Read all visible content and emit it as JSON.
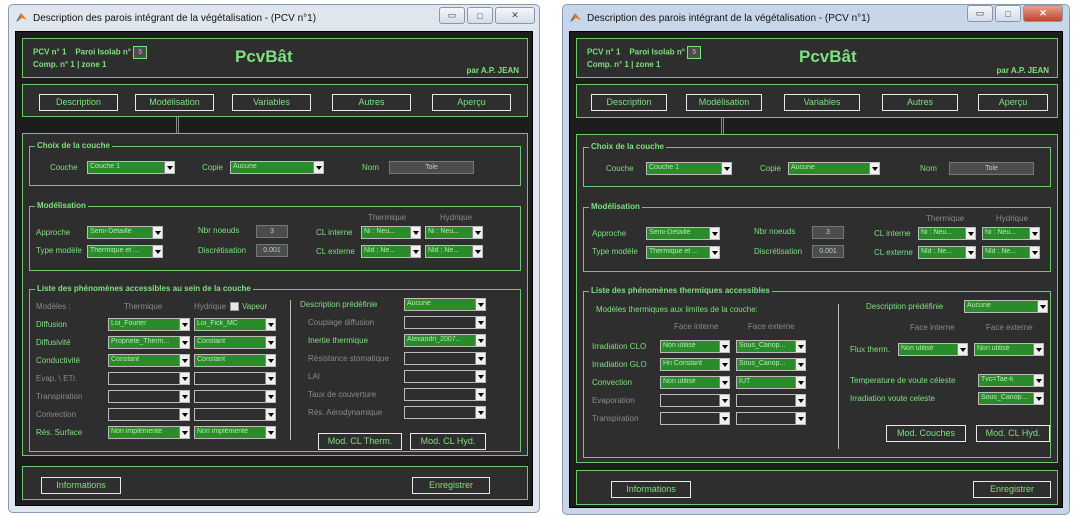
{
  "common": {
    "app_title": "PcvBât",
    "author": "par A.P. JEAN",
    "pcv_label": "PCV n° 1",
    "paroi_label": "Paroi Isolab n°",
    "paroi_value": "5",
    "comp_label": "Comp. n° 1 | zone 1",
    "tabs": [
      "Description",
      "Modélisation",
      "Variables",
      "Autres",
      "Aperçu"
    ],
    "informations_button": "Informations",
    "enregistrer_button": "Enregistrer",
    "choix_title": "Choix de la couche",
    "couche_label": "Couche",
    "couche_value": "Couche 1",
    "copie_label": "Copie",
    "copie_value": "Aucune",
    "nom_label": "Nom",
    "nom_value": "Tole",
    "model_title": "Modélisation",
    "approche_label": "Approche",
    "approche_value": "Semi-Détaillé",
    "type_label": "Type modèle",
    "type_value": "Thermique et ...",
    "noeuds_label": "Nbr noeuds",
    "noeuds_value": "3",
    "discret_label": "Discrétisation",
    "discret_value": "0.001",
    "thermique_hdr": "Thermique",
    "hydrique_hdr": "Hydrique",
    "cl_interne_label": "CL interne",
    "cl_externe_label": "CL externe",
    "cl_int_th": "Ni : Neu...",
    "cl_int_hy": "Ni : Neu...",
    "cl_ext_th": "Nld : Ne...",
    "cl_ext_hy": "Nld : Ne..."
  },
  "w1": {
    "title": "Description des parois intégrant de la végétalisation - (PCV n°1)",
    "phen_title": "Liste des phénomènes accessibles au sein de la couche",
    "modeles_label": "Modèles :",
    "thermique_hdr": "Thermique",
    "hydrique_hdr": "Hydrique",
    "vapeur_label": "Vapeur",
    "rows": [
      {
        "label": "Diffusion",
        "th": "Loi_Fourier",
        "hy": "Loi_Fick_MC",
        "active": true
      },
      {
        "label": "Diffusivité",
        "th": "Propriete_Therm...",
        "hy": "Constant",
        "active": true
      },
      {
        "label": "Conductivité",
        "th": "Constant",
        "hy": "Constant",
        "active": true
      },
      {
        "label": "Evap. \\ ETr.",
        "th": "",
        "hy": "",
        "active": false
      },
      {
        "label": "Transpiration",
        "th": "",
        "hy": "",
        "active": false
      },
      {
        "label": "Convection",
        "th": "",
        "hy": "",
        "active": false
      },
      {
        "label": "Rés. Surface",
        "th": "Non implémenté",
        "hy": "Non implémenté",
        "active": true
      }
    ],
    "desc_label": "Description  prédéfinie",
    "desc_value": "Aucune",
    "right_rows": [
      {
        "label": "Couplage diffusion",
        "value": "",
        "active": false
      },
      {
        "label": "Inertie thermique",
        "value": "Alexandri_2007...",
        "active": true
      },
      {
        "label": "Résistance stomatique",
        "value": "",
        "active": false
      },
      {
        "label": "LAI",
        "value": "",
        "active": false
      },
      {
        "label": "Taux de couverture",
        "value": "",
        "active": false
      },
      {
        "label": "Rés. Aérodynamique",
        "value": "",
        "active": false
      }
    ],
    "mod_cl_therm": "Mod. CL Therm.",
    "mod_cl_hyd": "Mod. CL Hyd."
  },
  "w2": {
    "title": "Description des parois intégrant de la végétalisation - (PCV n°1)",
    "phen_title": "Liste des phénomènes thermiques accessibles",
    "modeles_limits": "Modèles thermiques aux limites de la couche:",
    "face_interne": "Face interne",
    "face_externe": "Face externe",
    "rows": [
      {
        "label": "Irradiation CLO",
        "fi": "Non utilisé",
        "fe": "Sous_Canop...",
        "active": true
      },
      {
        "label": "Irradiation GLO",
        "fi": "Hri Constant",
        "fe": "Sous_Canop...",
        "active": true
      },
      {
        "label": "Convection",
        "fi": "Non utilisé",
        "fe": "IUT",
        "active": true
      },
      {
        "label": "Evaporation",
        "fi": "",
        "fe": "",
        "active": false
      },
      {
        "label": "Transpiration",
        "fi": "",
        "fe": "",
        "active": false
      }
    ],
    "desc_label": "Description  prédéfinie",
    "desc_value": "Aucune",
    "flux_label": "Flux therm.",
    "flux_fi": "Non utilisé",
    "flux_fe": "Non utilisé",
    "temp_voute_label": "Temperature de voute céleste",
    "temp_voute_value": "Tvc=Tae-k",
    "irr_voute_label": "Irradiation voute celeste",
    "irr_voute_value": "Sous_Canop...",
    "mod_couches": "Mod. Couches",
    "mod_cl_hyd": "Mod. CL Hyd."
  }
}
